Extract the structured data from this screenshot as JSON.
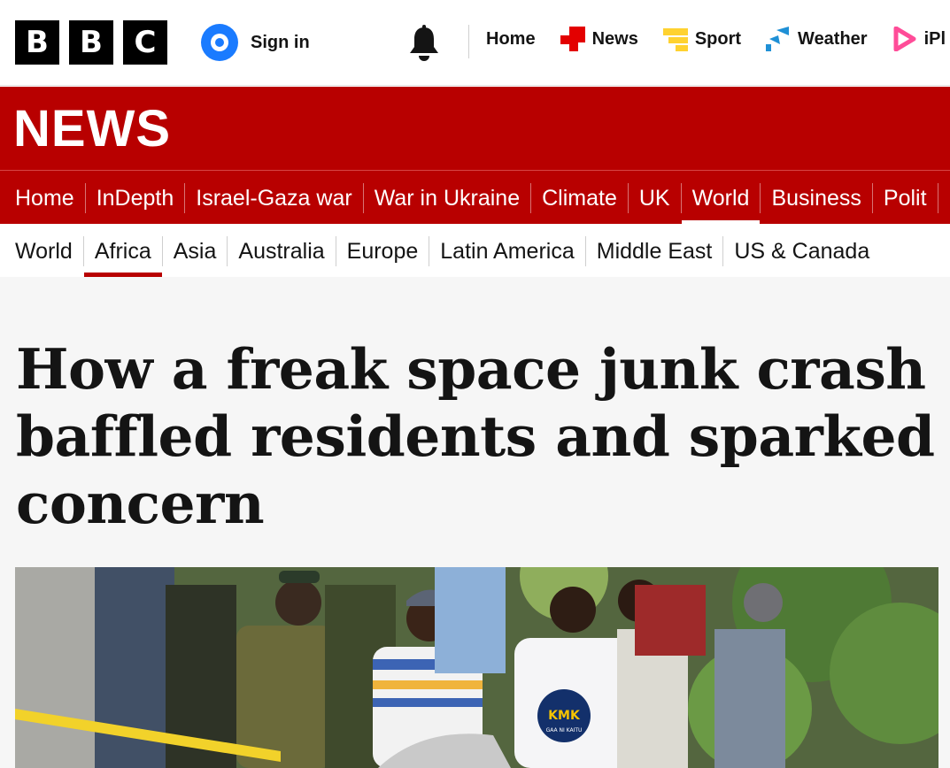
{
  "header": {
    "logo_letters": [
      "B",
      "B",
      "C"
    ],
    "signin_label": "Sign in",
    "nav": [
      {
        "label": "Home",
        "icon": "none"
      },
      {
        "label": "News",
        "icon": "news-icon"
      },
      {
        "label": "Sport",
        "icon": "sport-icon"
      },
      {
        "label": "Weather",
        "icon": "weather-icon"
      },
      {
        "label": "iPl",
        "icon": "iplayer-icon"
      }
    ]
  },
  "banner": {
    "title": "NEWS"
  },
  "main_nav": {
    "items": [
      "Home",
      "InDepth",
      "Israel-Gaza war",
      "War in Ukraine",
      "Climate",
      "UK",
      "World",
      "Business",
      "Polit"
    ],
    "active": "World"
  },
  "sub_nav": {
    "items": [
      "World",
      "Africa",
      "Asia",
      "Australia",
      "Europe",
      "Latin America",
      "Middle East",
      "US & Canada"
    ],
    "active": "Africa"
  },
  "article": {
    "headline": "How a freak space junk crash baffled residents and sparked concern"
  },
  "hero_image": {
    "shirt_text": "KMK",
    "shirt_subtext": "GAA NI KAITU"
  },
  "colors": {
    "brand_red": "#b80000",
    "news_icon": "#e30000",
    "sport_icon": "#ffd230",
    "weather_icon": "#1f90d6",
    "iplayer_icon": "#ff4c98",
    "signin_blue": "#1a7bff"
  }
}
